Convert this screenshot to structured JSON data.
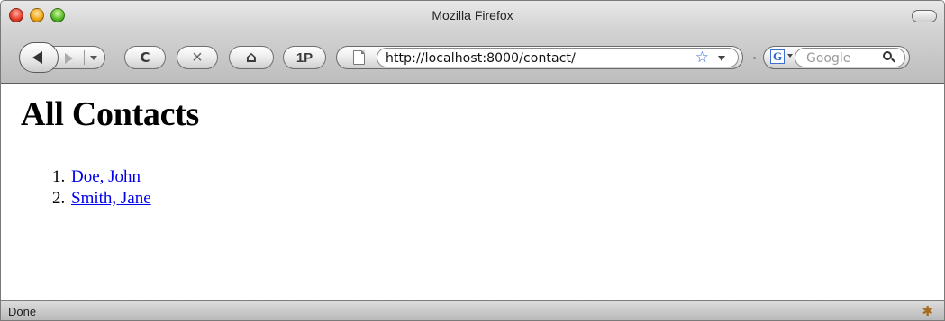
{
  "window": {
    "title": "Mozilla Firefox"
  },
  "toolbar": {
    "reload_glyph": "C",
    "stop_glyph": "×",
    "home_glyph": "⌂",
    "onepass_label": "1P",
    "url": "http://localhost:8000/contact/",
    "bookmark_star": "☆",
    "search_placeholder": "Google",
    "search_engine_glyph": "G"
  },
  "page": {
    "heading": "All Contacts",
    "contacts": [
      {
        "label": "Doe, John"
      },
      {
        "label": "Smith, Jane"
      }
    ]
  },
  "statusbar": {
    "text": "Done",
    "activity_glyph": "✱"
  },
  "icons": {
    "back": "back-arrow-icon",
    "forward": "forward-arrow-icon",
    "reload": "reload-icon",
    "stop": "stop-icon",
    "home": "home-icon",
    "page": "page-icon",
    "bookmark": "star-icon",
    "search": "magnifier-icon"
  },
  "colors": {
    "link": "#0000ee",
    "bookmark_star": "#3a6fd8",
    "close": "#e8422f",
    "minimize": "#f2a91b",
    "zoom": "#5bbf2b"
  }
}
